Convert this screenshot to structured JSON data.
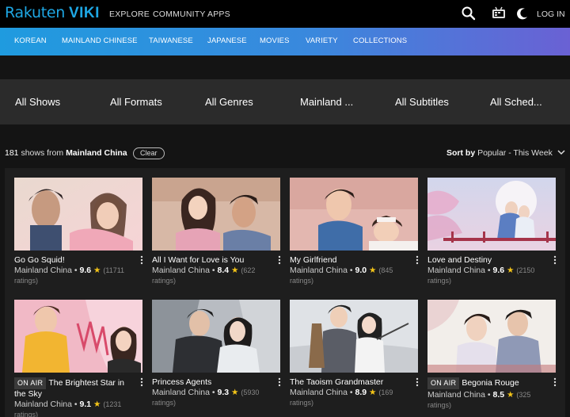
{
  "brand": {
    "rakuten": "Rakuten",
    "viki": "VIKI"
  },
  "topnav": {
    "explore": "EXPLORE",
    "community": "COMMUNITY",
    "apps": "APPS",
    "login": "LOG IN"
  },
  "genres": [
    "KOREAN",
    "MAINLAND CHINESE",
    "TAIWANESE",
    "JAPANESE",
    "MOVIES",
    "VARIETY",
    "COLLECTIONS"
  ],
  "filters": [
    "All Shows",
    "All Formats",
    "All Genres",
    "Mainland ...",
    "All Subtitles",
    "All Sched..."
  ],
  "results": {
    "count": "181",
    "text": "shows from",
    "place": "Mainland China",
    "clear": "Clear"
  },
  "sort": {
    "label": "Sort by",
    "value": "Popular - This Week"
  },
  "shows": [
    {
      "title": "Go Go Squid!",
      "onair": "",
      "region": "Mainland China",
      "rating": "9.6",
      "count": "(11711",
      "suffix": "ratings)"
    },
    {
      "title": "All I Want for Love is You",
      "onair": "",
      "region": "Mainland China",
      "rating": "8.4",
      "count": "(622",
      "suffix": "ratings)"
    },
    {
      "title": "My Girlfriend",
      "onair": "",
      "region": "Mainland China",
      "rating": "9.0",
      "count": "(845",
      "suffix": "ratings)"
    },
    {
      "title": "Love and Destiny",
      "onair": "",
      "region": "Mainland China",
      "rating": "9.6",
      "count": "(2150",
      "suffix": "ratings)"
    },
    {
      "title": "The Brightest Star in the Sky",
      "onair": "ON AIR",
      "region": "Mainland China",
      "rating": "9.1",
      "count": "(1231",
      "suffix": "ratings)"
    },
    {
      "title": "Princess Agents",
      "onair": "",
      "region": "Mainland China",
      "rating": "9.3",
      "count": "(5930",
      "suffix": "ratings)"
    },
    {
      "title": "The Taoism Grandmaster",
      "onair": "",
      "region": "Mainland China",
      "rating": "8.9",
      "count": "(169",
      "suffix": "ratings)"
    },
    {
      "title": "Begonia Rouge",
      "onair": "ON AIR",
      "region": "Mainland China",
      "rating": "8.5",
      "count": "(325",
      "suffix": "ratings)"
    }
  ],
  "colors": {
    "accent": "#1ea7e4",
    "star": "#f5c518",
    "genre_start": "#1f9bdf",
    "genre_end": "#6a61d4"
  }
}
